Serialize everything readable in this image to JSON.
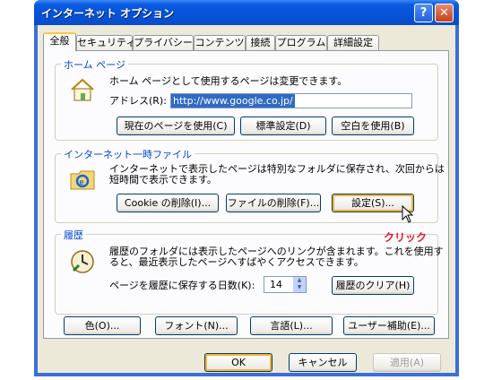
{
  "window": {
    "title": "インターネット オプション",
    "help": "?",
    "close": "✕"
  },
  "tabs": [
    "全般",
    "セキュリティ",
    "プライバシー",
    "コンテンツ",
    "接続",
    "プログラム",
    "詳細設定"
  ],
  "homepage": {
    "group_label": "ホーム ページ",
    "description": "ホーム ページとして使用するページは変更できます。",
    "address_label": "アドレス(R):",
    "address_value": "http://www.google.co.jp/",
    "use_current": "現在のページを使用(C)",
    "use_default": "標準設定(D)",
    "use_blank": "空白を使用(B)"
  },
  "temp_files": {
    "group_label": "インターネット一時ファイル",
    "description_line1": "インターネットで表示したページは特別なフォルダに保存され、次回からは",
    "description_line2": "短時間で表示できます。",
    "delete_cookies": "Cookie の削除(I)...",
    "delete_files": "ファイルの削除(F)...",
    "settings": "設定(S)..."
  },
  "history": {
    "group_label": "履歴",
    "description_line1": "履歴のフォルダには表示したページへのリンクが含まれます。これを使用す",
    "description_line2": "ると、最近表示したページへすばやくアクセスできます。",
    "days_label": "ページを履歴に保存する日数(K):",
    "days_value": "14",
    "clear": "履歴のクリア(H)"
  },
  "bottom_buttons": {
    "colors": "色(O)...",
    "fonts": "フォント(N)...",
    "languages": "言語(L)...",
    "accessibility": "ユーザー補助(E)..."
  },
  "dialog_buttons": {
    "ok": "OK",
    "cancel": "キャンセル",
    "apply": "適用(A)"
  },
  "annotation": {
    "click": "クリック"
  },
  "colors": {
    "accent": "#0046d5",
    "annotation": "#e8162b",
    "titlebar": "#0553d8"
  }
}
